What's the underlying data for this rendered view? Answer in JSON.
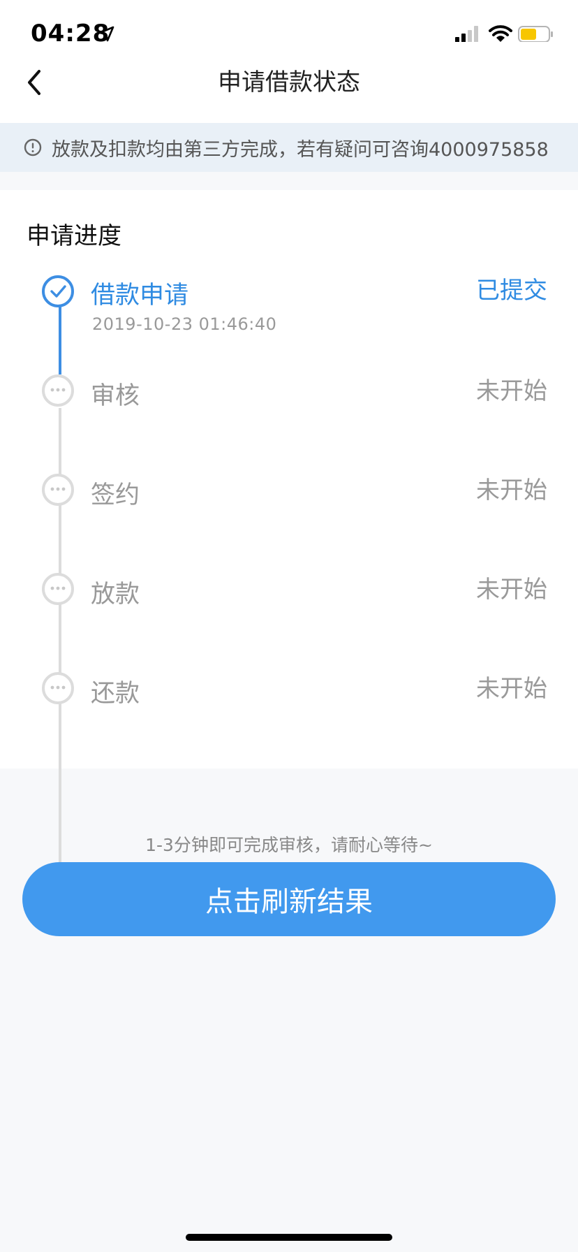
{
  "status_bar": {
    "time": "04:28"
  },
  "header": {
    "title": "申请借款状态"
  },
  "notice": {
    "text": "放款及扣款均由第三方完成，若有疑问可咨询4000975858"
  },
  "progress": {
    "section_title": "申请进度",
    "steps": [
      {
        "name": "借款申请",
        "date": "2019-10-23 01:46:40",
        "status": "已提交"
      },
      {
        "name": "审核",
        "status": "未开始"
      },
      {
        "name": "签约",
        "status": "未开始"
      },
      {
        "name": "放款",
        "status": "未开始"
      },
      {
        "name": "还款",
        "status": "未开始"
      }
    ]
  },
  "footer": {
    "hint": "1-3分钟即可完成审核，请耐心等待~",
    "refresh_label": "点击刷新结果"
  },
  "colors": {
    "accent": "#3d8ee3",
    "button": "#4199ee",
    "pending": "#999999"
  }
}
